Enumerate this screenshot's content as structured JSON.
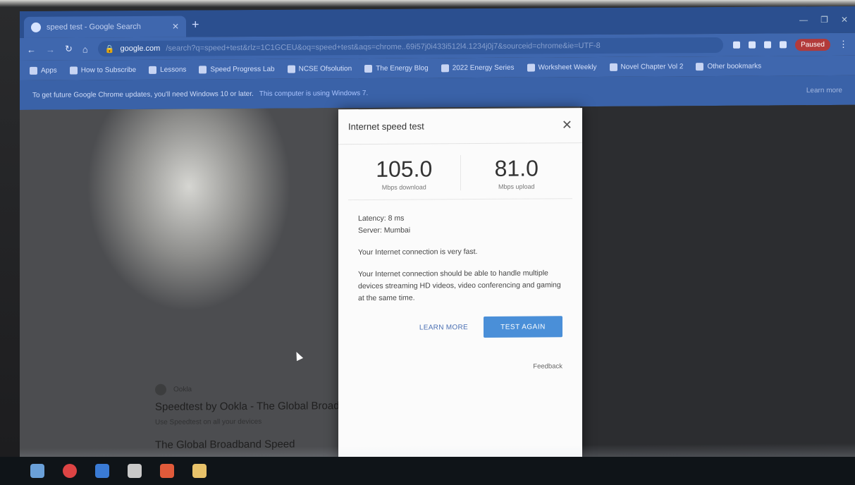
{
  "browser": {
    "tab_title": "speed test - Google Search",
    "address_domain": "google.com",
    "address_path": "/search?q=speed+test&rlz=1C1GCEU&oq=speed+test&aqs=chrome..69i57j0i433i512l4.1234j0j7&sourceid=chrome&ie=UTF-8",
    "bookmarks": [
      "Apps",
      "How to Subscribe",
      "Lessons",
      "Speed Progress Lab",
      "NCSE Ofsolution",
      "The Energy Blog",
      "2022 Energy Series",
      "Worksheet Weekly",
      "Novel Chapter Vol 2",
      "Other bookmarks"
    ],
    "profile_label": "Paused",
    "infobar_text": "To get future Google Chrome updates, you'll need Windows 10 or later.",
    "infobar_link": "This computer is using Windows 7.",
    "infobar_action": "Learn more"
  },
  "page": {
    "result_source": "Ookla",
    "result_headline": "Speedtest by Ookla - The Global Broadband Speed Test",
    "result_sub": "Use Speedtest on all your devices",
    "result_more": "The Global Broadband Speed"
  },
  "dialog": {
    "title": "Internet speed test",
    "download_value": "105.0",
    "download_unit": "Mbps download",
    "upload_value": "81.0",
    "upload_unit": "Mbps upload",
    "latency": "Latency: 8 ms",
    "server": "Server: Mumbai",
    "summary": "Your Internet connection is very fast.",
    "detail": "Your Internet connection should be able to handle multiple devices streaming HD videos, video conferencing and gaming at the same time.",
    "learn_more_label": "LEARN MORE",
    "test_again_label": "TEST AGAIN",
    "feedback_label": "Feedback"
  },
  "colors": {
    "chrome_blue": "#3f67ae",
    "primary_button": "#4a8fd8"
  }
}
